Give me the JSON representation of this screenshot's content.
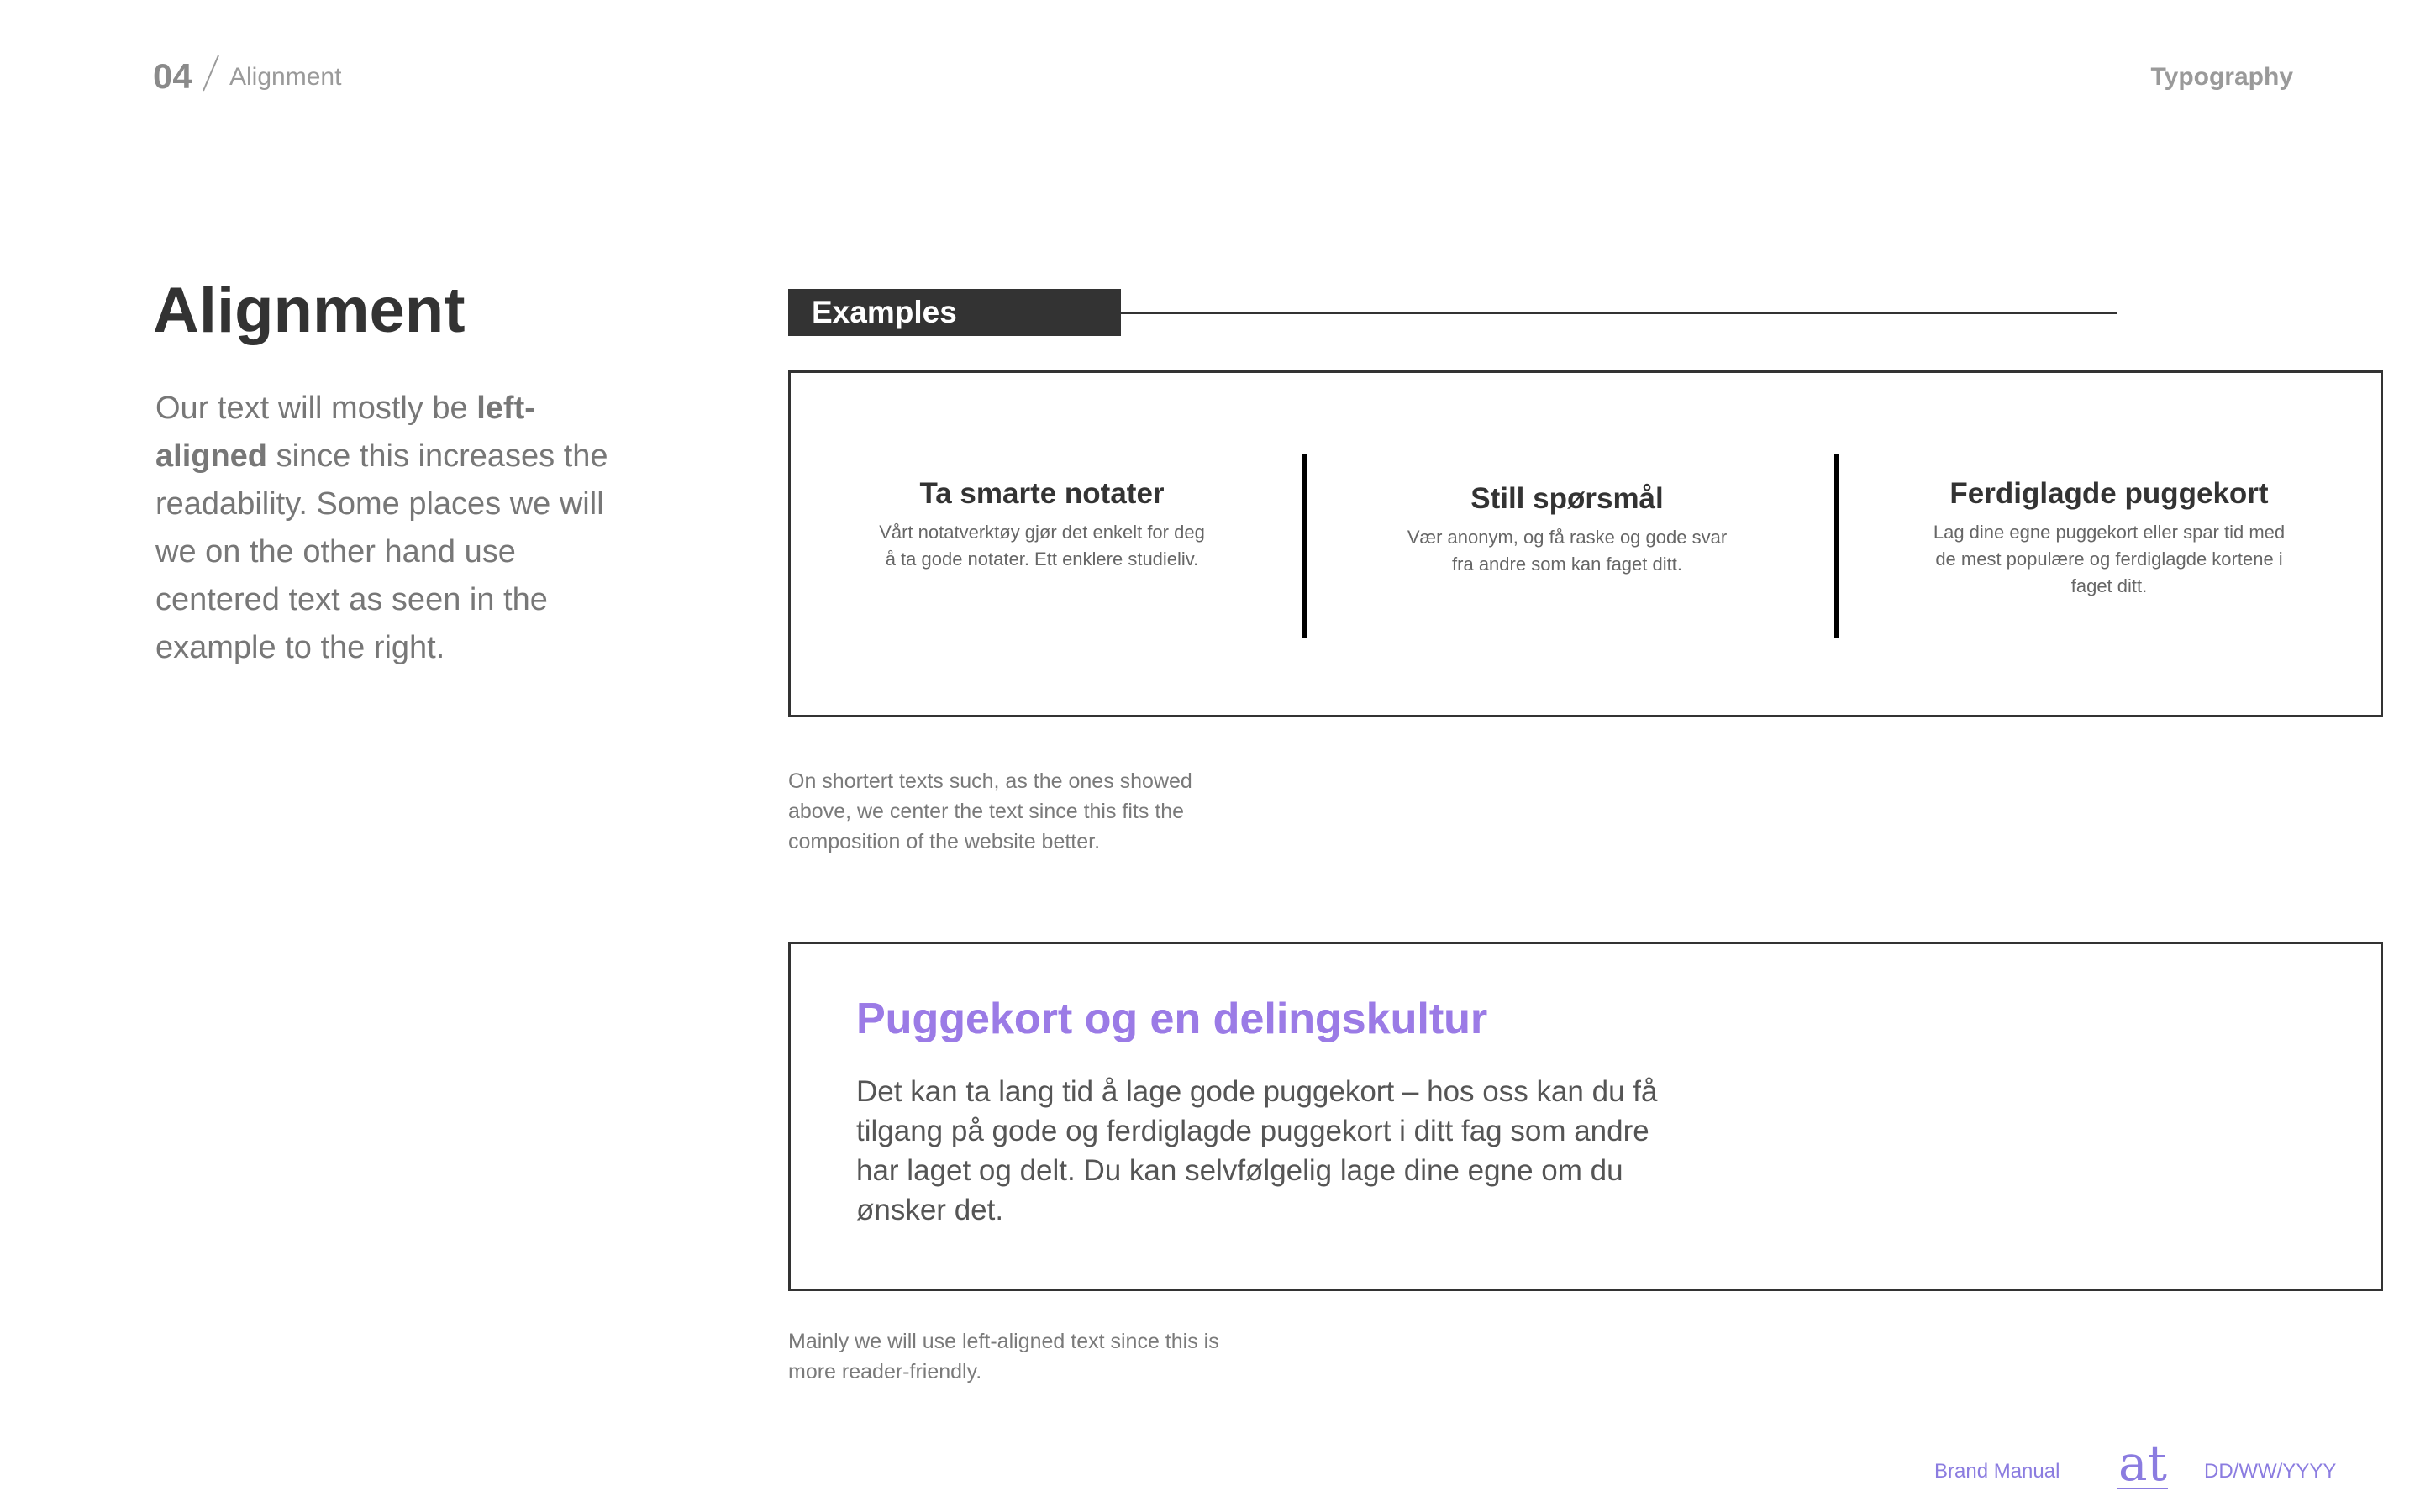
{
  "header": {
    "section_number": "04",
    "section_name": "Alignment",
    "chapter": "Typography"
  },
  "main": {
    "title": "Alignment",
    "intro": {
      "part1": "Our text will mostly be ",
      "bold": "left-aligned",
      "part2": " since this increases the readability. Some places we will we on the other hand use centered text as seen in the example to the right."
    }
  },
  "examples": {
    "label": "Examples",
    "cards": [
      {
        "title": "Ta smarte notater",
        "description": "Vårt notatverktøy gjør det enkelt for deg å ta gode notater. Ett enklere studieliv."
      },
      {
        "title": "Still spørsmål",
        "description": "Vær anonym, og få raske og gode svar fra andre som kan faget ditt."
      },
      {
        "title": "Ferdiglagde puggekort",
        "description": "Lag dine egne puggekort eller spar tid med de mest populære og ferdiglagde kortene i faget ditt."
      }
    ],
    "caption": "On shortert texts such, as the ones showed above, we center the text since this fits the composition of the website better."
  },
  "left_aligned_example": {
    "title": "Puggekort og en delingskultur",
    "body": "Det kan ta lang tid å lage gode puggekort – hos oss kan du få tilgang på gode og ferdiglagde puggekort i ditt fag som andre har laget og delt. Du kan selvfølgelig lage dine egne om du ønsker det.",
    "caption": "Mainly we will use left-aligned text since this is more reader-friendly."
  },
  "footer": {
    "brand": "Brand Manual",
    "logo_text": "at",
    "date": "DD/WW/YYYY"
  },
  "colors": {
    "accent": "#9b7be6",
    "dark": "#333333",
    "muted": "#777777"
  }
}
